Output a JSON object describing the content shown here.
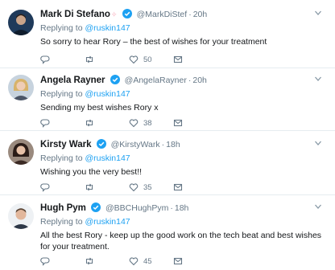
{
  "tweets": [
    {
      "name": "Mark Di Stefano",
      "emoji": "✧",
      "handle": "@MarkDiStef",
      "time": "20h",
      "replying_prefix": "Replying to",
      "replying_to": "@ruskin147",
      "text": "So sorry to hear Rory – the best of wishes for your treatment",
      "like_count": "50",
      "avatar": "dark-blue-portrait"
    },
    {
      "name": "Angela Rayner",
      "handle": "@AngelaRayner",
      "time": "20h",
      "replying_prefix": "Replying to",
      "replying_to": "@ruskin147",
      "text": "Sending my best wishes Rory x",
      "like_count": "38",
      "avatar": "blonde-portrait"
    },
    {
      "name": "Kirsty Wark",
      "handle": "@KirstyWark",
      "time": "18h",
      "replying_prefix": "Replying to",
      "replying_to": "@ruskin147",
      "text": "Wishing you the very best!!",
      "like_count": "35",
      "avatar": "dark-hair-portrait"
    },
    {
      "name": "Hugh Pym",
      "handle": "@BBCHughPym",
      "time": "18h",
      "replying_prefix": "Replying to",
      "replying_to": "@ruskin147",
      "text": "All the best Rory - keep up the good work on the tech beat and best wishes for your treatment.",
      "like_count": "45",
      "avatar": "man-portrait"
    }
  ],
  "colors": {
    "accent": "#1da1f2",
    "muted": "#657786",
    "text": "#14171a",
    "border": "#e6ecf0"
  },
  "icons": [
    "verified-icon",
    "chevron-down-icon",
    "reply-icon",
    "retweet-icon",
    "like-icon",
    "dm-icon"
  ]
}
